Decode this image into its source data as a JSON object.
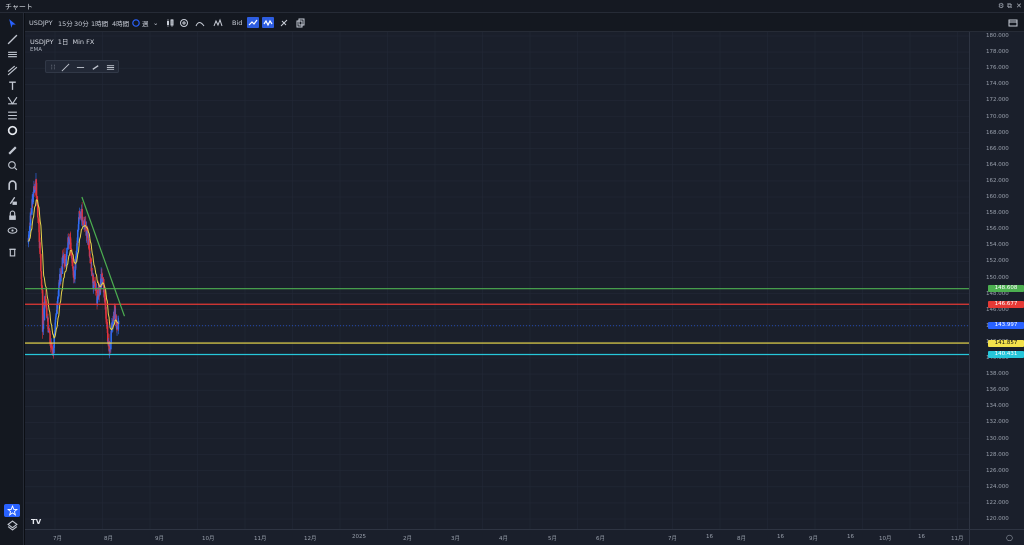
{
  "window": {
    "title": "チャート"
  },
  "toolbar": {
    "symbol": "USDJPY",
    "timeframes": [
      "15分",
      "30分",
      "1時間",
      "4時間"
    ],
    "period": "週",
    "bid": "Bid"
  },
  "legend": {
    "symbol": "USDJPY",
    "interval": "1日",
    "source": "Min FX",
    "indicator": "EMA"
  },
  "price_axis": {
    "ticks": [
      "180.000",
      "178.000",
      "176.000",
      "174.000",
      "172.000",
      "170.000",
      "168.000",
      "166.000",
      "164.000",
      "162.000",
      "160.000",
      "158.000",
      "156.000",
      "154.000",
      "152.000",
      "150.000",
      "148.000",
      "146.000",
      "144.000",
      "142.000",
      "140.000",
      "138.000",
      "136.000",
      "134.000",
      "132.000",
      "130.000",
      "128.000",
      "126.000",
      "124.000",
      "122.000",
      "120.000"
    ],
    "labels": [
      {
        "text": "148.608",
        "color": "#4caf50"
      },
      {
        "text": "146.677",
        "color": "#e53935"
      },
      {
        "text": "143.997",
        "color": "#2962ff"
      },
      {
        "text": "141.857",
        "color": "#f3e14b"
      },
      {
        "text": "140.431",
        "color": "#26c6da"
      }
    ]
  },
  "time_axis": {
    "ticks": [
      "7月",
      "8月",
      "9月",
      "10月",
      "11月",
      "12月",
      "2025",
      "2月",
      "3月",
      "4月",
      "5月",
      "6月",
      "7月",
      "16",
      "8月",
      "16",
      "9月",
      "16",
      "10月",
      "16",
      "11月",
      "16"
    ]
  },
  "chart_data": {
    "type": "candlestick",
    "symbol": "USDJPY",
    "interval": "1日",
    "ylim": [
      120,
      180
    ],
    "indicator": "EMA",
    "horizontal_lines": [
      148.608,
      146.677,
      141.857,
      140.431
    ],
    "last_price": 143.997,
    "trendline_start": {
      "x": "2025-01-05",
      "y": 160.0
    },
    "trendline_end": {
      "x": "2025-06-20",
      "y": 145.2
    },
    "x": [
      "2024-06-10",
      "2024-06-20",
      "2024-07-01",
      "2024-07-10",
      "2024-07-20",
      "2024-08-01",
      "2024-08-05",
      "2024-08-15",
      "2024-08-25",
      "2024-09-05",
      "2024-09-16",
      "2024-09-25",
      "2024-10-05",
      "2024-10-15",
      "2024-10-25",
      "2024-11-05",
      "2024-11-15",
      "2024-11-25",
      "2024-12-05",
      "2024-12-15",
      "2024-12-25",
      "2025-01-05",
      "2025-01-15",
      "2025-01-25",
      "2025-02-05",
      "2025-02-15",
      "2025-02-25",
      "2025-03-05",
      "2025-03-15",
      "2025-03-25",
      "2025-04-05",
      "2025-04-15",
      "2025-04-22",
      "2025-05-01",
      "2025-05-12",
      "2025-05-20",
      "2025-05-28"
    ],
    "close": [
      154.5,
      157.8,
      161.0,
      161.5,
      156.5,
      149.5,
      143.5,
      147.5,
      144.5,
      141.5,
      140.8,
      144.5,
      148.5,
      150.5,
      152.5,
      152.0,
      155.5,
      153.5,
      150.0,
      153.5,
      157.5,
      158.0,
      156.5,
      155.5,
      152.5,
      149.5,
      149.0,
      147.5,
      148.5,
      150.5,
      147.0,
      143.0,
      141.0,
      143.5,
      146.5,
      144.0,
      144.0
    ]
  }
}
